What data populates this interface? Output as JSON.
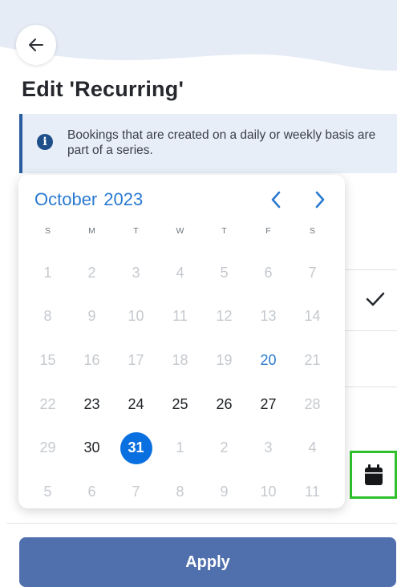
{
  "header": {
    "back_icon": "arrow-left-icon",
    "title": "Edit 'Recurring'"
  },
  "info_banner": {
    "icon": "info-icon",
    "icon_glyph": "i",
    "text": "Bookings that are created on a daily or weekly basis are part of a series."
  },
  "datepicker": {
    "month": "October",
    "year": "2023",
    "prev_icon": "chevron-left-icon",
    "next_icon": "chevron-right-icon",
    "weekdays": [
      "S",
      "M",
      "T",
      "W",
      "T",
      "F",
      "S"
    ],
    "days": [
      {
        "label": "1",
        "state": "disabled"
      },
      {
        "label": "2",
        "state": "disabled"
      },
      {
        "label": "3",
        "state": "disabled"
      },
      {
        "label": "4",
        "state": "disabled"
      },
      {
        "label": "5",
        "state": "disabled"
      },
      {
        "label": "6",
        "state": "disabled"
      },
      {
        "label": "7",
        "state": "disabled"
      },
      {
        "label": "8",
        "state": "disabled"
      },
      {
        "label": "9",
        "state": "disabled"
      },
      {
        "label": "10",
        "state": "disabled"
      },
      {
        "label": "11",
        "state": "disabled"
      },
      {
        "label": "12",
        "state": "disabled"
      },
      {
        "label": "13",
        "state": "disabled"
      },
      {
        "label": "14",
        "state": "disabled"
      },
      {
        "label": "15",
        "state": "disabled"
      },
      {
        "label": "16",
        "state": "disabled"
      },
      {
        "label": "17",
        "state": "disabled"
      },
      {
        "label": "18",
        "state": "disabled"
      },
      {
        "label": "19",
        "state": "disabled"
      },
      {
        "label": "20",
        "state": "today"
      },
      {
        "label": "21",
        "state": "disabled"
      },
      {
        "label": "22",
        "state": "disabled"
      },
      {
        "label": "23",
        "state": "active"
      },
      {
        "label": "24",
        "state": "active"
      },
      {
        "label": "25",
        "state": "active"
      },
      {
        "label": "26",
        "state": "active"
      },
      {
        "label": "27",
        "state": "active"
      },
      {
        "label": "28",
        "state": "disabled"
      },
      {
        "label": "29",
        "state": "disabled"
      },
      {
        "label": "30",
        "state": "active"
      },
      {
        "label": "31",
        "state": "selected"
      },
      {
        "label": "1",
        "state": "outside"
      },
      {
        "label": "2",
        "state": "outside"
      },
      {
        "label": "3",
        "state": "outside"
      },
      {
        "label": "4",
        "state": "disabled"
      },
      {
        "label": "5",
        "state": "disabled"
      },
      {
        "label": "6",
        "state": "outside"
      },
      {
        "label": "7",
        "state": "outside"
      },
      {
        "label": "8",
        "state": "outside"
      },
      {
        "label": "9",
        "state": "outside"
      },
      {
        "label": "10",
        "state": "outside"
      },
      {
        "label": "11",
        "state": "disabled"
      }
    ]
  },
  "background": {
    "check_icon": "checkmark-icon",
    "calendar_icon": "calendar-icon"
  },
  "footer": {
    "apply_label": "Apply"
  },
  "colors": {
    "accent": "#2a7ad0",
    "selected": "#0a70e0",
    "apply_button": "#5070ad",
    "highlight_border": "#2fc12c",
    "banner_bg": "#e7eef8",
    "banner_border": "#2a5d9f"
  }
}
